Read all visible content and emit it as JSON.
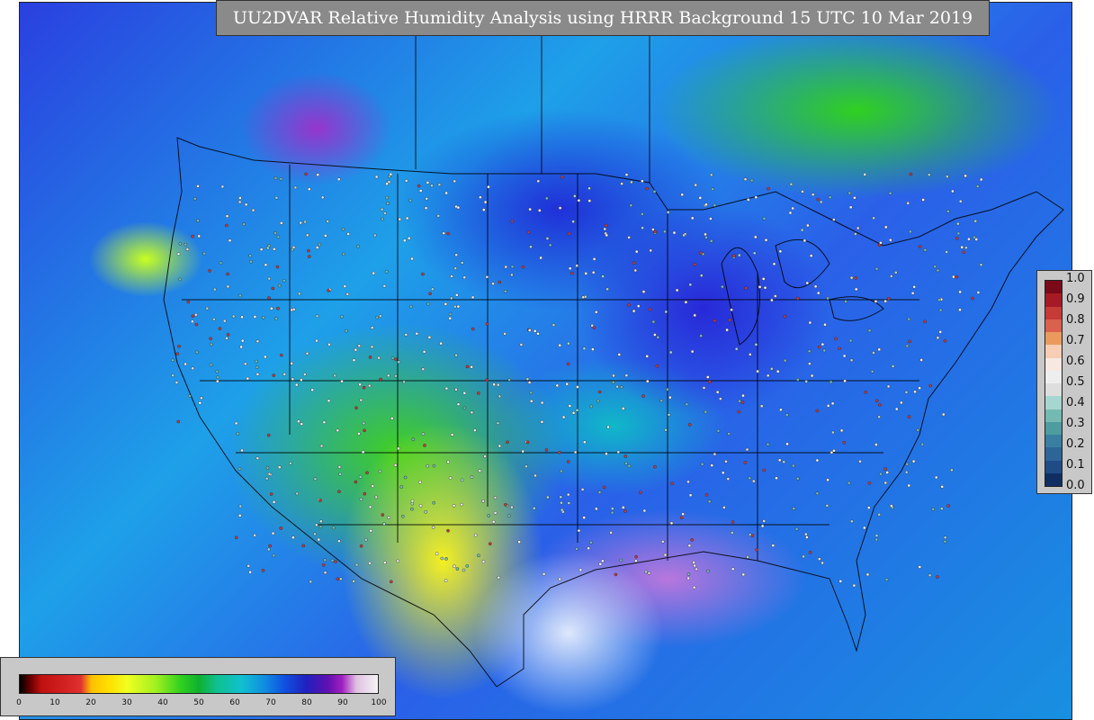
{
  "title": "UU2DVAR Relative Humidity Analysis using HRRR Background 15 UTC 10 Mar 2019",
  "vertical_colorbar": {
    "ticks": [
      "1.0",
      "0.9",
      "0.8",
      "0.7",
      "0.6",
      "0.5",
      "0.4",
      "0.3",
      "0.2",
      "0.1",
      "0.0"
    ],
    "colors": [
      "#7a0a18",
      "#a51a24",
      "#c63a38",
      "#d9614e",
      "#eb9a5e",
      "#f7cdb4",
      "#f7e8e2",
      "#eeeeee",
      "#dedede",
      "#a6d6d0",
      "#74bab2",
      "#4f9ca0",
      "#3a7fa2",
      "#2d6597",
      "#204c86",
      "#0f2f63"
    ]
  },
  "horizontal_colorbar": {
    "ticks": [
      "0",
      "10",
      "20",
      "30",
      "40",
      "50",
      "60",
      "70",
      "80",
      "90",
      "100"
    ]
  },
  "colors": {
    "banner_bg": "#8a8a8a",
    "colorbar_bg": "#c8c8c8"
  }
}
